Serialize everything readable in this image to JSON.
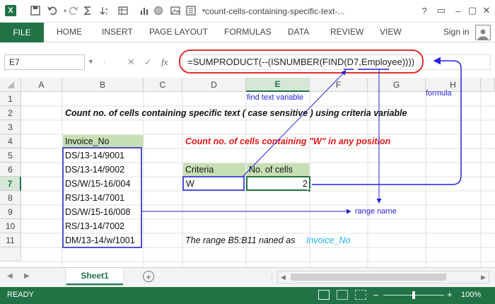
{
  "titlebar": {
    "logo": "X",
    "title": "count-cells-containing-specific-text-...",
    "controls": [
      "?",
      "▭",
      "–",
      "▢",
      "✕"
    ]
  },
  "ribbon": {
    "file_tab": "FILE",
    "tabs": [
      "HOME",
      "INSERT",
      "PAGE LAYOUT",
      "FORMULAS",
      "DATA",
      "REVIEW",
      "VIEW"
    ],
    "signin": "Sign in"
  },
  "formula_bar": {
    "name_box": "E7",
    "fx": "fx",
    "formula": "=SUMPRODUCT(--(ISNUMBER(FIND(D7,Employee))))"
  },
  "grid": {
    "columns": [
      "A",
      "B",
      "C",
      "D",
      "E",
      "F",
      "G",
      "H"
    ],
    "rows": [
      "1",
      "2",
      "3",
      "4",
      "5",
      "6",
      "7",
      "8",
      "9",
      "10",
      "11"
    ],
    "selected_column": "E",
    "selected_row": "7",
    "title": "Count no. of cells  containing specific text ( case sensitive ) using criteria variable",
    "invoice_header": "Invoice_No",
    "invoices": [
      "DS/13-14/9001",
      "DS/13-14/9002",
      "DS/W/15-16/004",
      "RS/13-14/7001",
      "DS/W/15-16/008",
      "RS/13-14/7002",
      "DM/13-14/w/1001"
    ],
    "count_label": "Count no. of cells containing \"W\" in any position",
    "criteria_header": "Criteria",
    "cells_header": "No. of cells",
    "criteria_value": "W",
    "result_value": "2",
    "range_note": "The range B5:B11 naned as",
    "range_name_value": "Invoice_No"
  },
  "annotations": {
    "find_text": "find text variable",
    "formula": "formula",
    "range_name": "range name"
  },
  "sheets": {
    "active": "Sheet1"
  },
  "status": {
    "ready": "READY",
    "zoom": "100%"
  },
  "colors": {
    "excel_green": "#217346",
    "header_fill": "#c6e0b4",
    "red_text": "#e01818",
    "annotation_blue": "#2222dd",
    "range_blue": "#22b0e0"
  }
}
